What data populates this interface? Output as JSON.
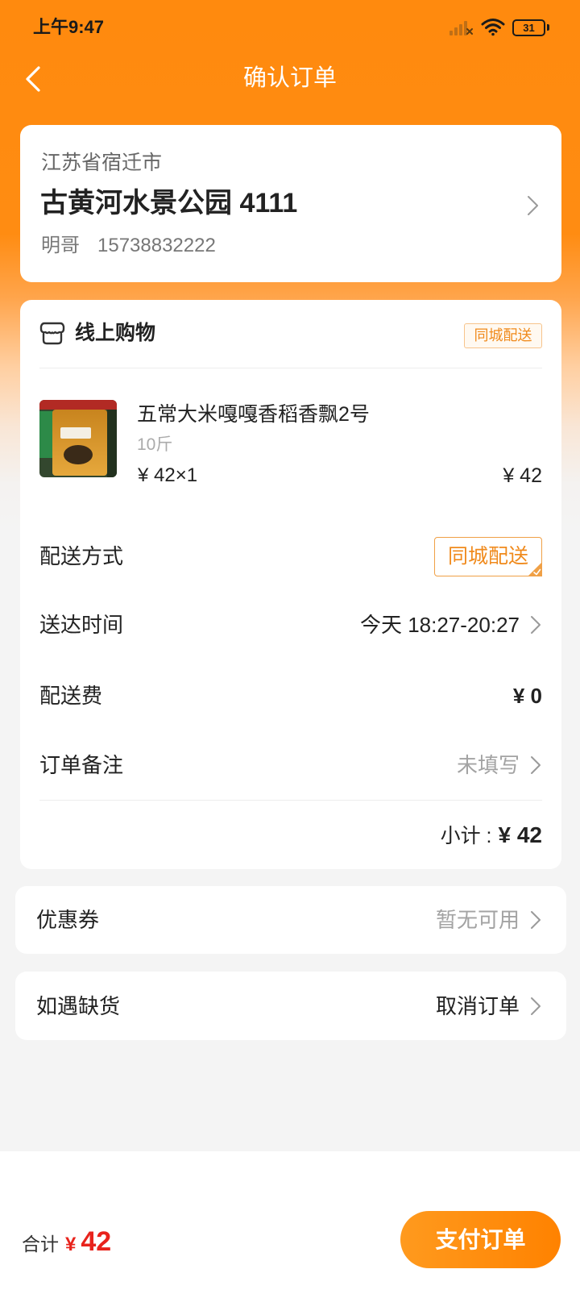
{
  "status_bar": {
    "time": "上午9:47",
    "battery": "31",
    "icons": [
      "signal-icon",
      "wifi-icon",
      "battery-icon"
    ]
  },
  "header": {
    "title": "确认订单",
    "back_icon": "chevron-left-icon"
  },
  "address": {
    "region": "江苏省宿迁市",
    "detail": "古黄河水景公园 4111",
    "name": "明哥",
    "phone": "15738832222"
  },
  "store": {
    "name": "线上购物",
    "icon": "store-icon",
    "delivery_tag": "同城配送"
  },
  "product": {
    "name": "五常大米嘎嘎香稻香飘2号",
    "spec": "10斤",
    "unit_price_qty": "¥ 42×1",
    "line_total": "¥ 42"
  },
  "order_rows": [
    {
      "label": "配送方式",
      "value": "同城配送"
    },
    {
      "label": "送达时间",
      "value": "今天 18:27-20:27"
    },
    {
      "label": "配送费",
      "value": "¥ 0"
    },
    {
      "label": "订单备注",
      "value": "未填写"
    }
  ],
  "subtotal": {
    "label": "小计 :",
    "value": "¥ 42"
  },
  "coupon": {
    "label": "优惠券",
    "value": "暂无可用"
  },
  "out_of_stock": {
    "label": "如遇缺货",
    "value": "取消订单"
  },
  "footer": {
    "total_label": "合计",
    "currency": "¥",
    "total": "42",
    "pay_button": "支付订单"
  },
  "colors": {
    "accent": "#FF8A0E",
    "price_red": "#E8231C",
    "tag_orange": "#F08A1C",
    "background": "#F4F4F4"
  }
}
